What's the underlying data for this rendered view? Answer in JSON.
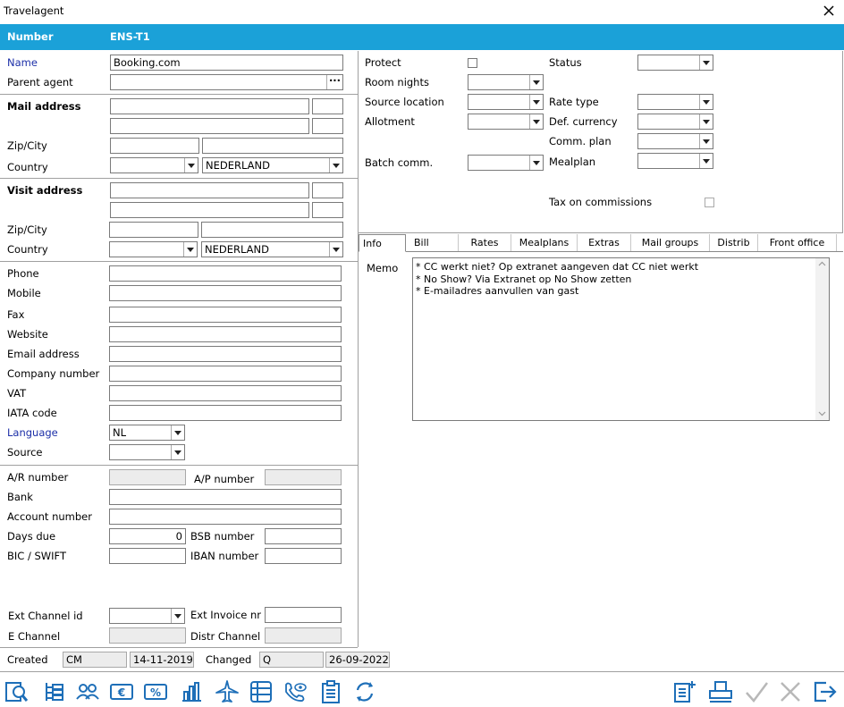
{
  "window": {
    "title": "Travelagent"
  },
  "header": {
    "label": "Number",
    "value": "ENS-T1"
  },
  "left": {
    "name_label": "Name",
    "name_value": "Booking.com",
    "parent_label": "Parent agent",
    "parent_btn": "···",
    "mail_label": "Mail address",
    "zipcity_label": "Zip/City",
    "country_label": "Country",
    "mail_country": "NEDERLAND",
    "visit_label": "Visit address",
    "visit_zipcity_label": "Zip/City",
    "visit_country_label": "Country",
    "visit_country": "NEDERLAND",
    "phone_label": "Phone",
    "mobile_label": "Mobile",
    "fax_label": "Fax",
    "website_label": "Website",
    "email_label": "Email address",
    "company_label": "Company number",
    "vat_label": "VAT",
    "iata_label": "IATA code",
    "language_label": "Language",
    "language_value": "NL",
    "source_label": "Source",
    "ar_label": "A/R number",
    "ap_label": "A/P number",
    "bank_label": "Bank",
    "account_label": "Account number",
    "days_label": "Days due",
    "days_value": "0",
    "bsb_label": "BSB number",
    "bic_label": "BIC / SWIFT",
    "iban_label": "IBAN number",
    "extchannel_label": "Ext Channel id",
    "extinvoice_label": "Ext Invoice nr",
    "echannel_label": "E Channel",
    "distr_label": "Distr Channel"
  },
  "right": {
    "protect_label": "Protect",
    "status_label": "Status",
    "roomnights_label": "Room nights",
    "sourceloc_label": "Source location",
    "ratetype_label": "Rate type",
    "allotment_label": "Allotment",
    "currency_label": "Def. currency",
    "commplan_label": "Comm. plan",
    "batch_label": "Batch comm.",
    "mealplan_label": "Mealplan",
    "tax_label": "Tax on commissions"
  },
  "tabs": [
    "Info",
    "Bill",
    "Rates",
    "Mealplans",
    "Extras",
    "Mail groups",
    "Distrib",
    "Front office"
  ],
  "memo": {
    "label": "Memo",
    "lines": [
      "* CC werkt niet? Op extranet aangeven dat CC niet werkt",
      "* No Show? Via Extranet op No Show zetten",
      "* E-mailadres aanvullen van gast"
    ]
  },
  "footer": {
    "created_label": "Created",
    "created_by": "CM",
    "created_date": "14-11-2019",
    "changed_label": "Changed",
    "changed_by": "Q",
    "changed_date": "26-09-2022"
  },
  "colors": {
    "header_bg": "#1ba1d8",
    "header_text": "#ffffff",
    "label_blue": "#1c2fa8",
    "icon_blue": "#1e6fb8"
  },
  "toolbar_icons": [
    "search-document-icon",
    "tree-list-icon",
    "users-icon",
    "euro-icon",
    "percent-icon",
    "bar-chart-icon",
    "airplane-icon",
    "grid-icon",
    "phone-eye-icon",
    "clipboard-icon",
    "refresh-icon",
    "add-list-icon",
    "printer-icon",
    "check-icon",
    "cancel-icon",
    "exit-icon"
  ]
}
